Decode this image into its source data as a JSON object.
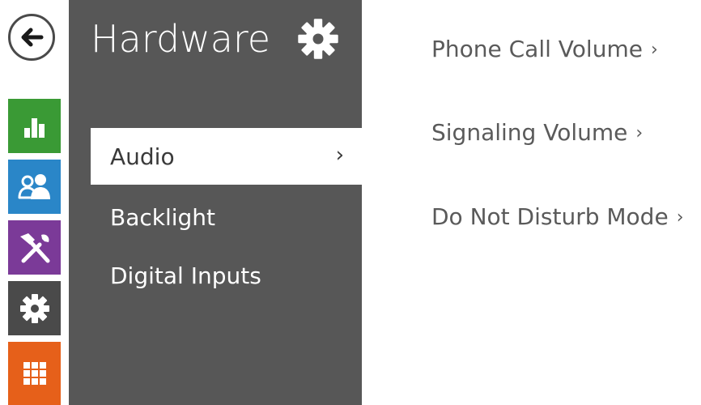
{
  "rail": {
    "back_label": "Back",
    "colors": {
      "status": "#3a9a35",
      "directory": "#2a86c8",
      "services": "#7b3a98",
      "hardware": "#4a4a4a",
      "system": "#e6601a"
    },
    "icons": [
      "arrow-left-icon",
      "bar-chart-icon",
      "users-icon",
      "tools-icon",
      "gear-icon",
      "grid-icon"
    ]
  },
  "panel": {
    "title": "Hardware",
    "title_icon": "gear-icon",
    "background": "#575757",
    "items": [
      {
        "label": "Audio",
        "active": true,
        "chevron": "›"
      },
      {
        "label": "Backlight",
        "active": false
      },
      {
        "label": "Digital Inputs",
        "active": false
      }
    ]
  },
  "content": {
    "links": [
      {
        "label": "Phone Call Volume",
        "chevron": "›"
      },
      {
        "label": "Signaling Volume",
        "chevron": "›"
      },
      {
        "label": "Do Not Disturb Mode",
        "chevron": "›"
      }
    ]
  }
}
